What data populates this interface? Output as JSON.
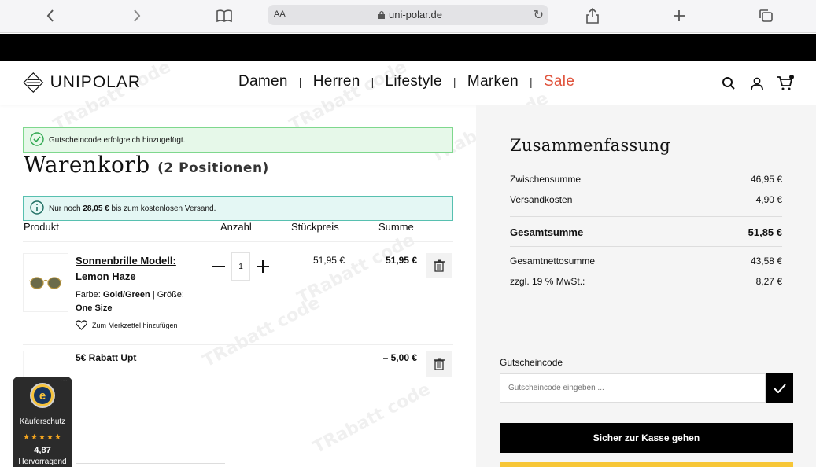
{
  "browser": {
    "text_size_label": "AA",
    "url": "uni-polar.de"
  },
  "header": {
    "logo_text": "UNIPOLAR",
    "nav": [
      {
        "label": "Damen"
      },
      {
        "label": "Herren"
      },
      {
        "label": "Lifestyle"
      },
      {
        "label": "Marken"
      },
      {
        "label": "Sale"
      }
    ],
    "sale_color": "#e0533c"
  },
  "alerts": {
    "success": "Gutscheincode erfolgreich hinzugefügt.",
    "shipping_prefix": "Nur noch",
    "shipping_amount": "28,05 €",
    "shipping_suffix": "bis zum kostenlosen Versand."
  },
  "cart": {
    "title": "Warenkorb",
    "count": "(2 Positionen)",
    "columns": {
      "product": "Produkt",
      "qty": "Anzahl",
      "unit_price": "Stückpreis",
      "sum": "Summe"
    },
    "items": [
      {
        "name": "Sonnenbrille Modell: Lemon Haze",
        "color_label": "Farbe:",
        "color_value": "Gold/Green",
        "size_label": "| Größe:",
        "size_value": "One Size",
        "wishlist": "Zum Merkzettel hinzufügen",
        "quantity": "1",
        "unit_price": "51,95 €",
        "sum": "51,95 €"
      }
    ],
    "coupon": {
      "name": "5€ Rabatt Upt",
      "value": "– 5,00 €"
    }
  },
  "summary": {
    "title": "Zusammenfassung",
    "subtotal_label": "Zwischensumme",
    "subtotal": "46,95 €",
    "shipping_label": "Versandkosten",
    "shipping": "4,90 €",
    "total_label": "Gesamtsumme",
    "total": "51,85 €",
    "net_label": "Gesamtnettosumme",
    "net": "43,58 €",
    "vat_label": "zzgl. 19 % MwSt.:",
    "vat": "8,27 €",
    "voucher_label": "Gutscheincode",
    "voucher_placeholder": "Gutscheincode eingeben ...",
    "checkout": "Sicher zur Kasse gehen"
  },
  "trust": {
    "label": "Käuferschutz",
    "stars": "★★★★★",
    "rating": "4,87",
    "verdict": "Hervorragend",
    "seal_letter": "e"
  }
}
